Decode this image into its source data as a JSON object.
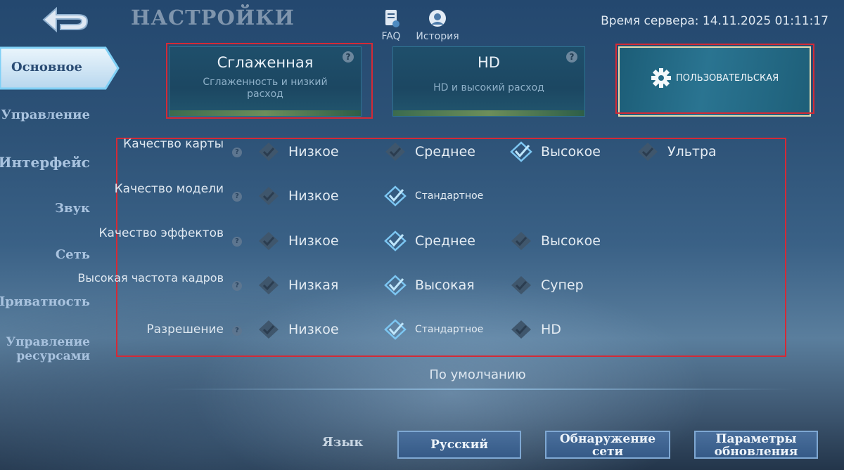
{
  "header": {
    "title": "НАСТРОЙКИ",
    "faq_label": "FAQ",
    "history_label": "История",
    "server_time": "Время сервера: 14.11.2025 01:11:17"
  },
  "sidebar": {
    "items": [
      {
        "label": "Основное",
        "active": true
      },
      {
        "label": "Управление"
      },
      {
        "label": "Интерфейс"
      },
      {
        "label": "Звук"
      },
      {
        "label": "Сеть"
      },
      {
        "label": "Приватность"
      },
      {
        "label": "Управление ресурсами"
      }
    ]
  },
  "presets": {
    "smooth": {
      "title": "Сглаженная",
      "subtitle": "Сглаженность и низкий расход",
      "help": "?"
    },
    "hd": {
      "title": "HD",
      "subtitle": "HD и высокий расход",
      "help": "?"
    },
    "custom": {
      "title": "ПОЛЬЗОВАТЕЛЬСКАЯ",
      "selected": true,
      "icon": "gear-icon"
    }
  },
  "settings": {
    "help": "?",
    "map_quality": {
      "label": "Качество карты",
      "options": [
        "Низкое",
        "Среднее",
        "Высокое",
        "Ультра"
      ],
      "selected": 2
    },
    "model_quality": {
      "label": "Качество модели",
      "options": [
        "Низкое",
        "Стандартное"
      ],
      "selected": 1
    },
    "effects_quality": {
      "label": "Качество эффектов",
      "options": [
        "Низкое",
        "Среднее",
        "Высокое"
      ],
      "selected": 1
    },
    "high_fps": {
      "label": "Высокая частота кадров",
      "options": [
        "Низкая",
        "Высокая",
        "Супер"
      ],
      "selected": 1
    },
    "resolution": {
      "label": "Разрешение",
      "options": [
        "Низкое",
        "Стандартное",
        "HD"
      ],
      "selected": 1
    }
  },
  "default_label": "По умолчанию",
  "footer": {
    "language_label": "Язык",
    "language_value": "Русский",
    "network_button": "Обнаружение сети",
    "update_button": "Параметры обновления"
  },
  "colors": {
    "highlight_box": "#d42a36",
    "selected_check": "#7cc6f2",
    "unselected_check": "#3f566c"
  }
}
